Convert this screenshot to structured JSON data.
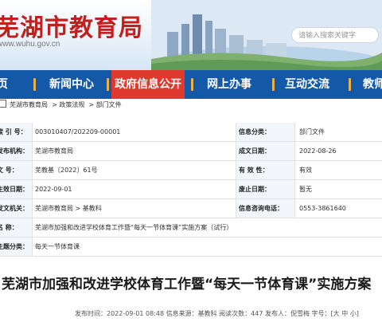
{
  "header": {
    "site_title": "芜湖市教育局",
    "site_domain": "www.wuhu.gov.cn",
    "search_placeholder": "请输入搜索关键字"
  },
  "nav": {
    "items": [
      "页",
      "新闻中心",
      "政府信息公开",
      "网上办事",
      "互动交流",
      "教师"
    ],
    "active_index": 2
  },
  "breadcrumb": [
    "芜湖市教育局",
    "政策法规",
    "部门文件"
  ],
  "info": {
    "rows": [
      {
        "label1": "索 引 号：",
        "value1": "003010407/202209-00001",
        "label2": "信息分类：",
        "value2": "部门文件"
      },
      {
        "label1": "发布机构：",
        "value1": "芜湖市教育局",
        "label2": "成文日期：",
        "value2": "2022-08-26"
      },
      {
        "label1": "文 号：",
        "value1": "芜教基〔2022〕61号",
        "label2": "有 效 性：",
        "value2": "有效"
      },
      {
        "label1": "生效日期：",
        "value1": "2022-09-01",
        "label2": "废止日期：",
        "value2": "暂无"
      },
      {
        "label1": "发文机关：",
        "value1": "芜湖市教育局 > 基教科",
        "label2": "信息咨询电话：",
        "value2": "0553-3861640"
      },
      {
        "label1": "名 称：",
        "value1": "芜湖市加强和改进学校体育工作暨“每天一节体育课”实施方案（试行）",
        "label2": "",
        "value2": ""
      },
      {
        "label1": "主题分类：",
        "value1": "每天一节体育课",
        "label2": "",
        "value2": ""
      }
    ]
  },
  "article": {
    "title": "芜湖市加强和改进学校体育工作暨“每天一节体育课”实施方案",
    "meta": "发布时间：2022-09-01 08:48  信息来源：基教科  阅读次数：447  发布人：倪雪梅  字号：[大 中 小]"
  },
  "colors": {
    "nav_bg": "#1459a8",
    "nav_active": "#e03a2e",
    "title_red": "#c21f1f"
  }
}
